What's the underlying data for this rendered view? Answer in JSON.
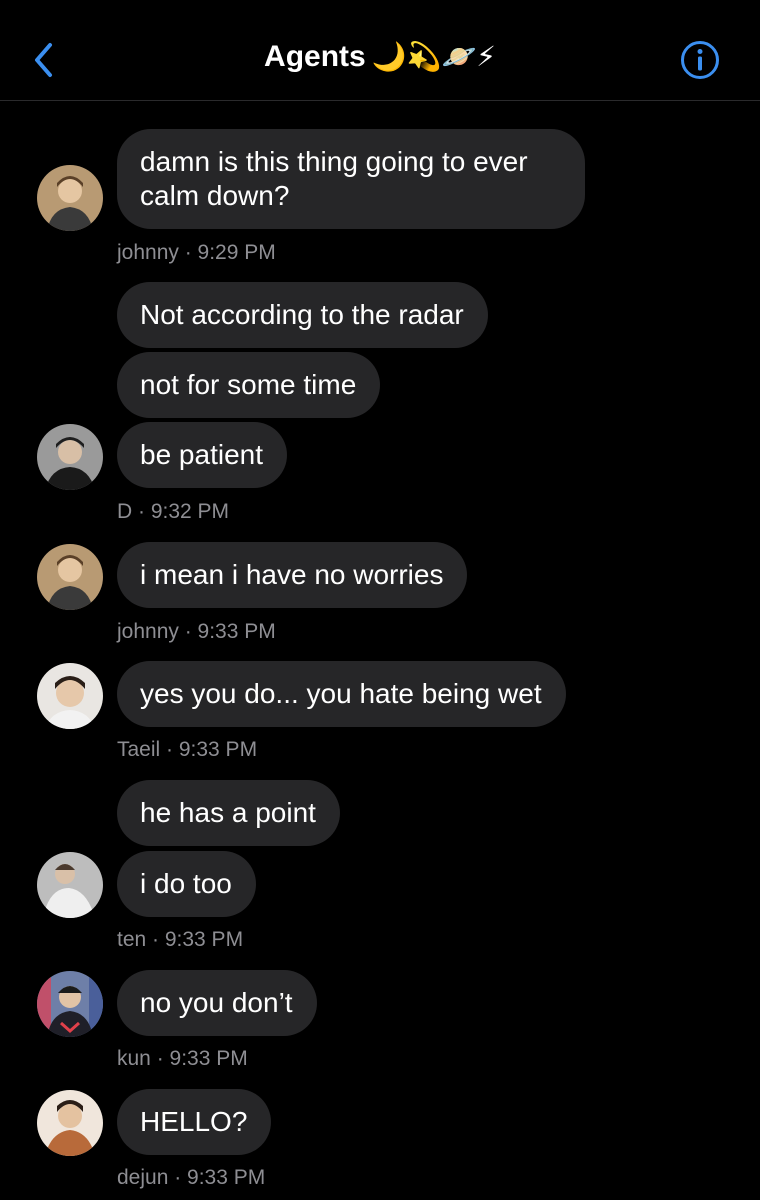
{
  "header": {
    "title": "Agents",
    "title_emoji": "🌙💫🪐⚡",
    "back_icon": "chevron-left-icon",
    "info_icon": "info-icon",
    "accent_color": "#3b8ff0"
  },
  "messages": [
    {
      "text": "damn is this thing going to ever calm down?"
    },
    {
      "text": "Not according to the radar"
    },
    {
      "text": "not for some time"
    },
    {
      "text": "be patient"
    },
    {
      "text": "i mean i have no worries"
    },
    {
      "text": "yes you do... you hate being wet"
    },
    {
      "text": "he has a point"
    },
    {
      "text": "i do too"
    },
    {
      "text": "no you don’t"
    },
    {
      "text": "HELLO?"
    }
  ],
  "metas": [
    {
      "text": "johnny · 9:29 PM"
    },
    {
      "text": "D · 9:32 PM"
    },
    {
      "text": "johnny · 9:33 PM"
    },
    {
      "text": "Taeil · 9:33 PM"
    },
    {
      "text": "ten · 9:33 PM"
    },
    {
      "text": "kun · 9:33 PM"
    },
    {
      "text": "dejun · 9:33 PM"
    }
  ],
  "colors": {
    "background": "#000000",
    "bubble": "#262628",
    "meta_text": "#8e8e93"
  }
}
